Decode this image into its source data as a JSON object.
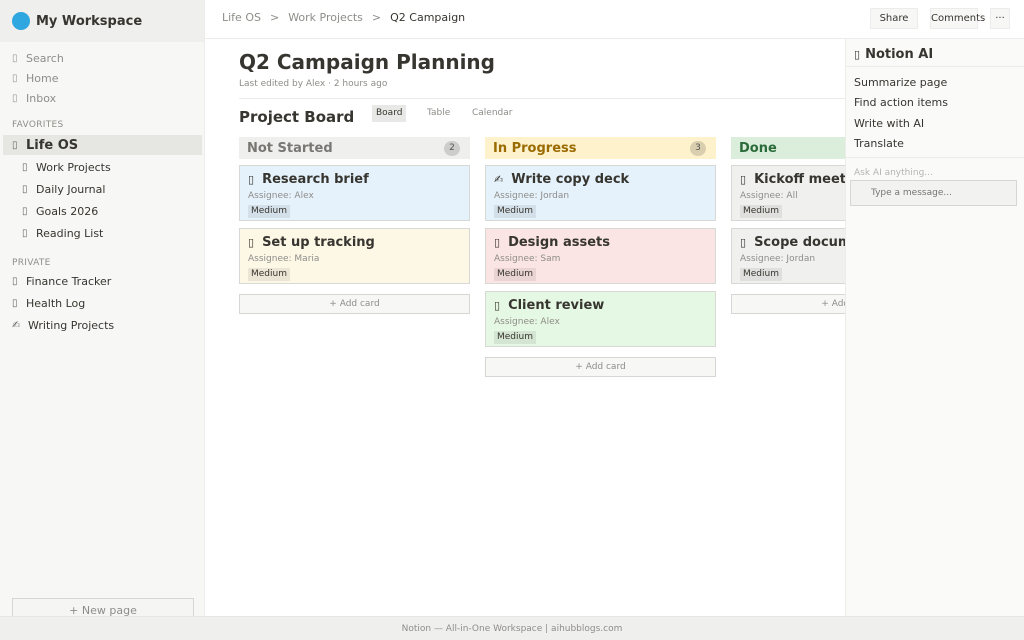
{
  "workspace": {
    "name": "My Workspace"
  },
  "nav": [
    {
      "icon": "search-icon",
      "glyph": "▯",
      "label": "Search"
    },
    {
      "icon": "home-icon",
      "glyph": "▯",
      "label": "Home"
    },
    {
      "icon": "inbox-icon",
      "glyph": "▯",
      "label": "Inbox"
    }
  ],
  "favorites": {
    "label": "FAVORITES",
    "root": {
      "icon": "page-icon",
      "glyph": "▯",
      "label": "Life OS"
    },
    "children": [
      {
        "icon": "page-icon",
        "glyph": "▯",
        "label": "Work Projects"
      },
      {
        "icon": "page-icon",
        "glyph": "▯",
        "label": "Daily Journal"
      },
      {
        "icon": "page-icon",
        "glyph": "▯",
        "label": "Goals 2026"
      },
      {
        "icon": "page-icon",
        "glyph": "▯",
        "label": "Reading List"
      }
    ]
  },
  "private": {
    "label": "PRIVATE",
    "items": [
      {
        "icon": "page-icon",
        "glyph": "▯",
        "label": "Finance Tracker"
      },
      {
        "icon": "page-icon",
        "glyph": "▯",
        "label": "Health Log"
      },
      {
        "icon": "pencil-icon",
        "glyph": "✍",
        "label": "Writing Projects"
      }
    ]
  },
  "new_page_label": "+ New page",
  "breadcrumb": {
    "items": [
      "Life OS",
      "Work Projects",
      "Q2 Campaign"
    ],
    "separator": ">"
  },
  "toolbar": {
    "share": "Share",
    "comments": "Comments",
    "more": "···"
  },
  "page": {
    "title": "Q2 Campaign Planning",
    "edited": "Last edited by Alex · 2 hours ago"
  },
  "board": {
    "title": "Project Board",
    "views": [
      "Board",
      "Table",
      "Calendar"
    ],
    "active_view": "Board",
    "add_card_label": "+ Add card",
    "columns": [
      {
        "name": "Not Started",
        "count": "2",
        "head_bg": "#efefed",
        "head_color": "#787774",
        "cards": [
          {
            "icon_glyph": "▯",
            "title": "Research brief",
            "assignee": "Assignee: Alex",
            "tag": "Medium",
            "bg": "#e5f2fb"
          },
          {
            "icon_glyph": "▯",
            "title": "Set up tracking",
            "assignee": "Assignee: Maria",
            "tag": "Medium",
            "bg": "#fdf7e6"
          }
        ]
      },
      {
        "name": "In Progress",
        "count": "3",
        "head_bg": "#fdf2cc",
        "head_color": "#9a6b00",
        "cards": [
          {
            "icon_glyph": "✍",
            "title": "Write copy deck",
            "assignee": "Assignee: Jordan",
            "tag": "Medium",
            "bg": "#e5f2fb"
          },
          {
            "icon_glyph": "▯",
            "title": "Design assets",
            "assignee": "Assignee: Sam",
            "tag": "Medium",
            "bg": "#fbe5e4"
          },
          {
            "icon_glyph": "▯",
            "title": "Client review",
            "assignee": "Assignee: Alex",
            "tag": "Medium",
            "bg": "#e5f8e3"
          }
        ]
      },
      {
        "name": "Done",
        "count": "",
        "head_bg": "#dbeddb",
        "head_color": "#2b6b3a",
        "cards": [
          {
            "icon_glyph": "▯",
            "title": "Kickoff meeting",
            "assignee": "Assignee: All",
            "tag": "Medium",
            "bg": "#f0f0ee"
          },
          {
            "icon_glyph": "▯",
            "title": "Scope document",
            "assignee": "Assignee: Jordan",
            "tag": "Medium",
            "bg": "#f0f0ee"
          }
        ]
      }
    ]
  },
  "ai": {
    "title": "Notion AI",
    "title_glyph": "▯",
    "actions": [
      "Summarize page",
      "Find action items",
      "Write with AI",
      "Translate"
    ],
    "ask_label": "Ask AI anything...",
    "input_placeholder": "Type a message..."
  },
  "footer": "Notion — All-in-One Workspace | aihubblogs.com"
}
